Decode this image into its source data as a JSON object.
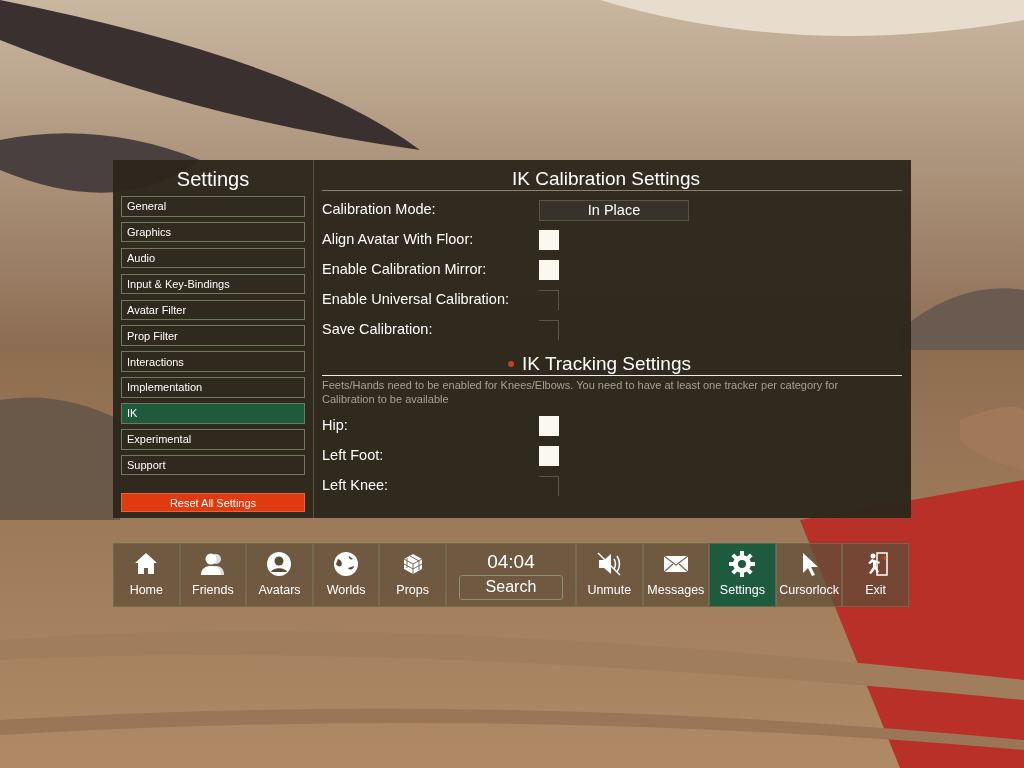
{
  "sidebar": {
    "title": "Settings",
    "items": [
      {
        "label": "General",
        "selected": false
      },
      {
        "label": "Graphics",
        "selected": false
      },
      {
        "label": "Audio",
        "selected": false
      },
      {
        "label": "Input & Key-Bindings",
        "selected": false
      },
      {
        "label": "Avatar Filter",
        "selected": false
      },
      {
        "label": "Prop Filter",
        "selected": false
      },
      {
        "label": "Interactions",
        "selected": false
      },
      {
        "label": "Implementation",
        "selected": false
      },
      {
        "label": "IK",
        "selected": true
      },
      {
        "label": "Experimental",
        "selected": false
      },
      {
        "label": "Support",
        "selected": false
      }
    ],
    "reset_button": "Reset All Settings"
  },
  "calibration": {
    "title": "IK Calibration Settings",
    "rows": [
      {
        "kind": "dropdown",
        "label": "Calibration Mode:",
        "value": "In Place"
      },
      {
        "kind": "checkbox",
        "label": "Align Avatar With Floor:",
        "checked": false
      },
      {
        "kind": "checkbox",
        "label": "Enable Calibration Mirror:",
        "checked": false
      },
      {
        "kind": "empty",
        "label": "Enable Universal Calibration:"
      },
      {
        "kind": "empty",
        "label": "Save Calibration:"
      }
    ]
  },
  "tracking": {
    "title": "IK Tracking Settings",
    "note": "Feets/Hands need to be enabled for Knees/Elbows. You need to have at least one tracker per category for Calibration to be available",
    "rows": [
      {
        "kind": "checkbox",
        "label": "Hip:",
        "checked": false
      },
      {
        "kind": "checkbox",
        "label": "Left Foot:",
        "checked": false
      },
      {
        "kind": "empty",
        "label": "Left Knee:"
      }
    ]
  },
  "taskbar": {
    "left": [
      {
        "label": "Home",
        "selected": false
      },
      {
        "label": "Friends",
        "selected": false
      },
      {
        "label": "Avatars",
        "selected": false
      },
      {
        "label": "Worlds",
        "selected": false
      },
      {
        "label": "Props",
        "selected": false
      }
    ],
    "clock": "04:04",
    "search": "Search",
    "right": [
      {
        "label": "Unmute",
        "selected": false
      },
      {
        "label": "Messages",
        "selected": false
      },
      {
        "label": "Settings",
        "selected": true
      },
      {
        "label": "Cursorlock",
        "selected": false
      },
      {
        "label": "Exit",
        "selected": false
      }
    ]
  }
}
